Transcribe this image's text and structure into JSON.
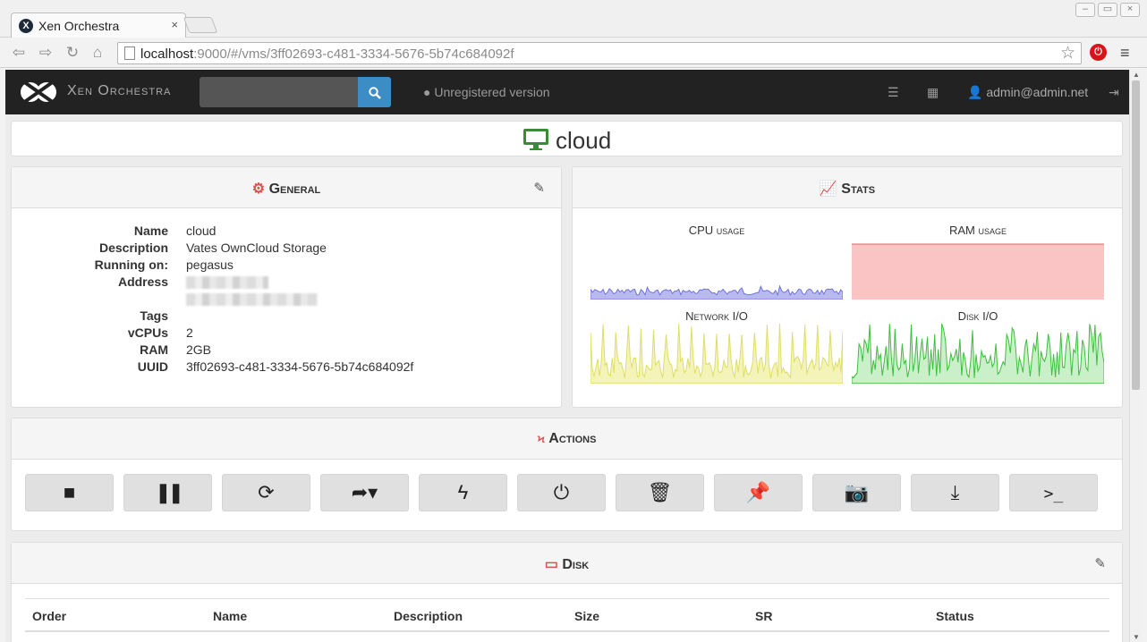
{
  "browser": {
    "tab_title": "Xen Orchestra",
    "tab_favicon": "X",
    "tab_close": "×",
    "url_host": "localhost",
    "url_rest": ":9000/#/vms/3ff02693-c481-3334-5676-5b74c684092f"
  },
  "nav": {
    "brand": "Xen Orchestra",
    "search_placeholder": "",
    "unregistered": "Unregistered version",
    "user": "admin@admin.net"
  },
  "vm": {
    "title": "cloud"
  },
  "general": {
    "title": "General",
    "fields": [
      {
        "label": "Name",
        "value": "cloud"
      },
      {
        "label": "Description",
        "value": "Vates OwnCloud Storage"
      },
      {
        "label": "Running on:",
        "value": "pegasus"
      },
      {
        "label": "Address",
        "value": ""
      },
      {
        "label": "Tags",
        "value": ""
      },
      {
        "label": "vCPUs",
        "value": "2"
      },
      {
        "label": "RAM",
        "value": "2GB"
      },
      {
        "label": "UUID",
        "value": "3ff02693-c481-3334-5676-5b74c684092f"
      }
    ]
  },
  "stats": {
    "title": "Stats",
    "cpu": "CPU usage",
    "ram": "RAM usage",
    "network": "Network I/O",
    "disk": "Disk I/O",
    "colors": {
      "cpu": "#7b7fe0",
      "ram": "#f08080",
      "network": "#e3e36a",
      "disk": "#4ccc4c"
    }
  },
  "actions": {
    "title": "Actions",
    "buttons": [
      {
        "name": "stop-icon",
        "glyph": "■"
      },
      {
        "name": "pause-icon",
        "glyph": "❚❚"
      },
      {
        "name": "restart-icon",
        "glyph": "⟳"
      },
      {
        "name": "migrate-icon",
        "glyph": "➦▾"
      },
      {
        "name": "force-icon",
        "glyph": "ϟ"
      },
      {
        "name": "power-icon",
        "glyph": "⏻"
      },
      {
        "name": "trash-icon",
        "glyph": "🗑"
      },
      {
        "name": "pin-icon",
        "glyph": "📌"
      },
      {
        "name": "camera-icon",
        "glyph": "📷"
      },
      {
        "name": "download-icon",
        "glyph": "⤓"
      },
      {
        "name": "console-icon",
        "glyph": ">_"
      }
    ]
  },
  "disk": {
    "title": "Disk",
    "columns": [
      "Order",
      "Name",
      "Description",
      "Size",
      "SR",
      "Status"
    ]
  }
}
